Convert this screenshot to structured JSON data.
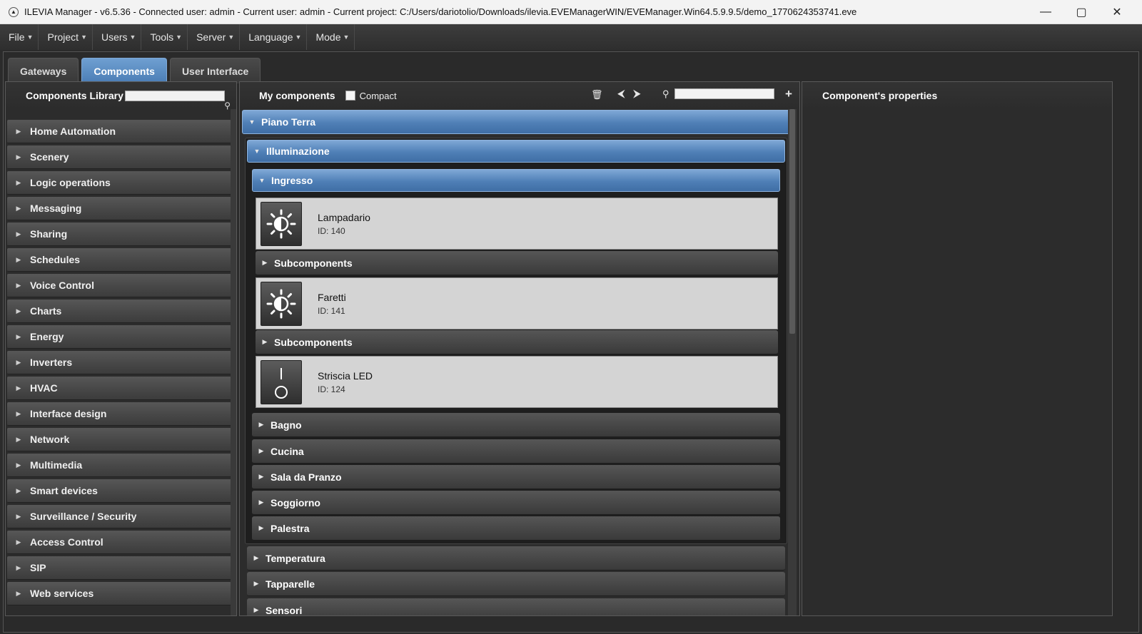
{
  "window": {
    "title": "ILEVIA Manager - v6.5.36 - Connected user: admin - Current user: admin - Current project: C:/Users/dariotolio/Downloads/ilevia.EVEManagerWIN/EVEManager.Win64.5.9.9.5/demo_1770624353741.eve",
    "minimize": "—",
    "maximize": "▢",
    "close": "✕"
  },
  "menu": [
    {
      "label": "File"
    },
    {
      "label": "Project"
    },
    {
      "label": "Users"
    },
    {
      "label": "Tools"
    },
    {
      "label": "Server"
    },
    {
      "label": "Language"
    },
    {
      "label": "Mode"
    }
  ],
  "tabs": [
    {
      "label": "Gateways",
      "active": false
    },
    {
      "label": "Components",
      "active": true
    },
    {
      "label": "User Interface",
      "active": false
    }
  ],
  "library": {
    "title": "Components Library",
    "search_value": "",
    "items": [
      "Home Automation",
      "Scenery",
      "Logic operations",
      "Messaging",
      "Sharing",
      "Schedules",
      "Voice Control",
      "Charts",
      "Energy",
      "Inverters",
      "HVAC",
      "Interface design",
      "Network",
      "Multimedia",
      "Smart devices",
      "Surveillance / Security",
      "Access Control",
      "SIP",
      "Web services"
    ]
  },
  "my_components": {
    "title": "My components",
    "compact_label": "Compact",
    "compact_checked": false,
    "search_value": "",
    "groups": {
      "floor": "Piano Terra",
      "category": "Illuminazione",
      "room": "Ingresso",
      "components": [
        {
          "name": "Lampadario",
          "id": "ID: 140",
          "icon": "sun-icon"
        },
        {
          "name": "Faretti",
          "id": "ID: 141",
          "icon": "sun-icon"
        },
        {
          "name": "Striscia LED",
          "id": "ID: 124",
          "icon": "switch-icon"
        }
      ],
      "subcomponents_label": "Subcomponents",
      "other_rooms": [
        "Bagno",
        "Cucina",
        "Sala da Pranzo",
        "Soggiorno",
        "Palestra"
      ],
      "other_categories": [
        "Temperatura",
        "Tapparelle",
        "Sensori"
      ]
    }
  },
  "properties": {
    "title": "Component's properties"
  }
}
